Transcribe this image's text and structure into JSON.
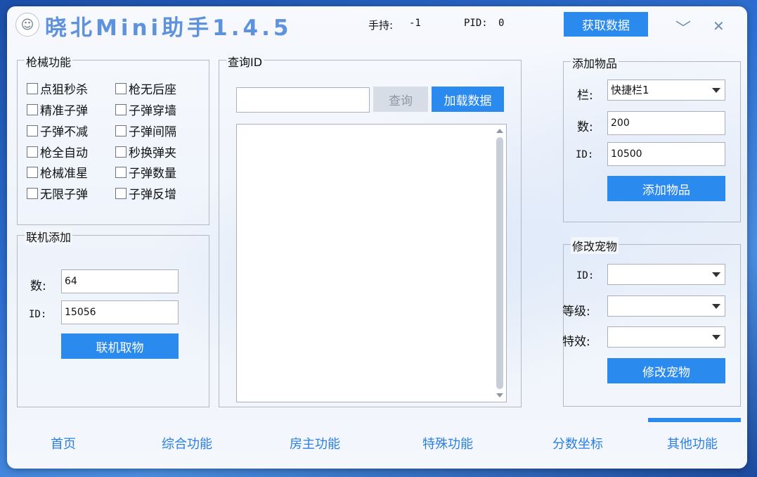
{
  "app": {
    "title": "晓北Mini助手1.4.5",
    "logo_icon": "avatar-icon"
  },
  "header": {
    "hold_label": "手持:",
    "hold_value": "-1",
    "pid_label": "PID:",
    "pid_value": "0",
    "fetch_button": "获取数据",
    "minimize_glyph": "﹀",
    "close_glyph": "✕"
  },
  "gun": {
    "title": "枪械功能",
    "left": [
      "点狙秒杀",
      "精准子弹",
      "子弹不减",
      "枪全自动",
      "枪械准星",
      "无限子弹"
    ],
    "right": [
      "枪无后座",
      "子弹穿墙",
      "子弹间隔",
      "秒换弹夹",
      "子弹数量",
      "子弹反增"
    ]
  },
  "online": {
    "title": "联机添加",
    "count_label": "数:",
    "count_value": "64",
    "id_label": "ID:",
    "id_value": "15056",
    "button": "联机取物"
  },
  "query": {
    "title": "查询ID",
    "input_value": "",
    "query_button": "查询",
    "load_button": "加载数据"
  },
  "add_item": {
    "title": "添加物品",
    "slot_label": "栏:",
    "slot_value": "快捷栏1",
    "count_label": "数:",
    "count_value": "200",
    "id_label": "ID:",
    "id_value": "10500",
    "button": "添加物品"
  },
  "pet": {
    "title": "修改宠物",
    "id_label": "ID:",
    "id_value": "",
    "level_label": "等级:",
    "level_value": "",
    "effect_label": "特效:",
    "effect_value": "",
    "button": "修改宠物"
  },
  "nav": [
    "首页",
    "综合功能",
    "房主功能",
    "特殊功能",
    "分数坐标",
    "其他功能"
  ],
  "colors": {
    "accent": "#2b8aee",
    "title": "#5e92dd",
    "nav_text": "#2b7fe3"
  }
}
